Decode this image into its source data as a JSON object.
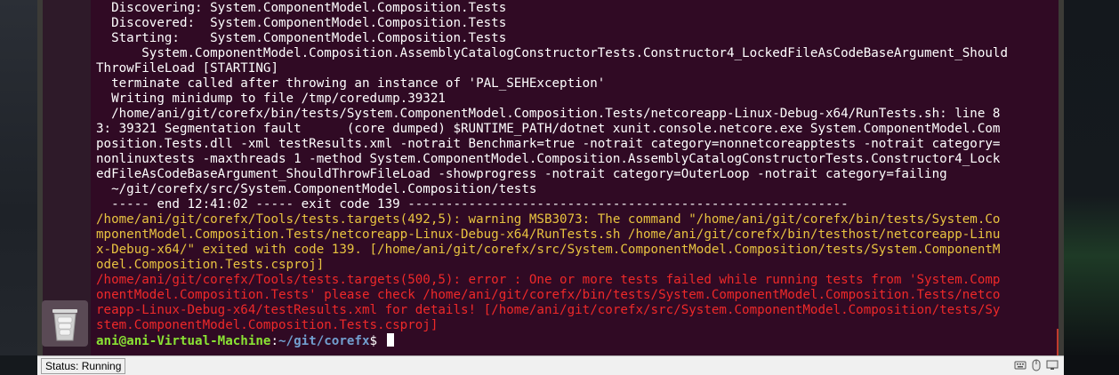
{
  "terminal": {
    "lines": [
      {
        "text": "  Discovering: System.ComponentModel.Composition.Tests",
        "kind": "normal"
      },
      {
        "text": "  Discovered:  System.ComponentModel.Composition.Tests",
        "kind": "normal"
      },
      {
        "text": "  Starting:    System.ComponentModel.Composition.Tests",
        "kind": "normal"
      },
      {
        "text": "      System.ComponentModel.Composition.AssemblyCatalogConstructorTests.Constructor4_LockedFileAsCodeBaseArgument_Should",
        "kind": "normal"
      },
      {
        "text": "ThrowFileLoad [STARTING]",
        "kind": "normal"
      },
      {
        "text": "  terminate called after throwing an instance of 'PAL_SEHException'",
        "kind": "normal"
      },
      {
        "text": "  Writing minidump to file /tmp/coredump.39321",
        "kind": "normal"
      },
      {
        "text": "  /home/ani/git/corefx/bin/tests/System.ComponentModel.Composition.Tests/netcoreapp-Linux-Debug-x64/RunTests.sh: line 8",
        "kind": "normal"
      },
      {
        "text": "3: 39321 Segmentation fault      (core dumped) $RUNTIME_PATH/dotnet xunit.console.netcore.exe System.ComponentModel.Com",
        "kind": "normal"
      },
      {
        "text": "position.Tests.dll -xml testResults.xml -notrait Benchmark=true -notrait category=nonnetcoreapptests -notrait category=",
        "kind": "normal"
      },
      {
        "text": "nonlinuxtests -maxthreads 1 -method System.ComponentModel.Composition.AssemblyCatalogConstructorTests.Constructor4_Lock",
        "kind": "normal"
      },
      {
        "text": "edFileAsCodeBaseArgument_ShouldThrowFileLoad -showprogress -notrait category=OuterLoop -notrait category=failing",
        "kind": "normal"
      },
      {
        "text": "  ~/git/corefx/src/System.ComponentModel.Composition/tests",
        "kind": "normal"
      },
      {
        "text": "  ----- end 12:41:02 ----- exit code 139 ----------------------------------------------------------",
        "kind": "normal"
      },
      {
        "text": "/home/ani/git/corefx/Tools/tests.targets(492,5): warning MSB3073: The command \"/home/ani/git/corefx/bin/tests/System.Co",
        "kind": "warn"
      },
      {
        "text": "mponentModel.Composition.Tests/netcoreapp-Linux-Debug-x64/RunTests.sh /home/ani/git/corefx/bin/testhost/netcoreapp-Linu",
        "kind": "warn"
      },
      {
        "text": "x-Debug-x64/\" exited with code 139. [/home/ani/git/corefx/src/System.ComponentModel.Composition/tests/System.ComponentM",
        "kind": "warn"
      },
      {
        "text": "odel.Composition.Tests.csproj]",
        "kind": "warn"
      },
      {
        "text": "/home/ani/git/corefx/Tools/tests.targets(500,5): error : One or more tests failed while running tests from 'System.Comp",
        "kind": "err"
      },
      {
        "text": "onentModel.Composition.Tests' please check /home/ani/git/corefx/bin/tests/System.ComponentModel.Composition.Tests/netco",
        "kind": "err"
      },
      {
        "text": "reapp-Linux-Debug-x64/testResults.xml for details! [/home/ani/git/corefx/src/System.ComponentModel.Composition/tests/Sy",
        "kind": "err"
      },
      {
        "text": "stem.ComponentModel.Composition.Tests.csproj]",
        "kind": "err"
      }
    ],
    "prompt": {
      "user_host": "ani@ani-Virtual-Machine",
      "separator": ":",
      "path": "~/git/corefx",
      "symbol": "$ "
    }
  },
  "statusbar": {
    "status": "Status: Running",
    "icons": [
      "keyboard-icon",
      "mouse-icon",
      "display-icon"
    ]
  },
  "colors": {
    "terminal_bg": "#300a24",
    "warning": "#e8c340",
    "error": "#ef2929",
    "prompt_user": "#8ae234",
    "prompt_path": "#729fcf"
  }
}
